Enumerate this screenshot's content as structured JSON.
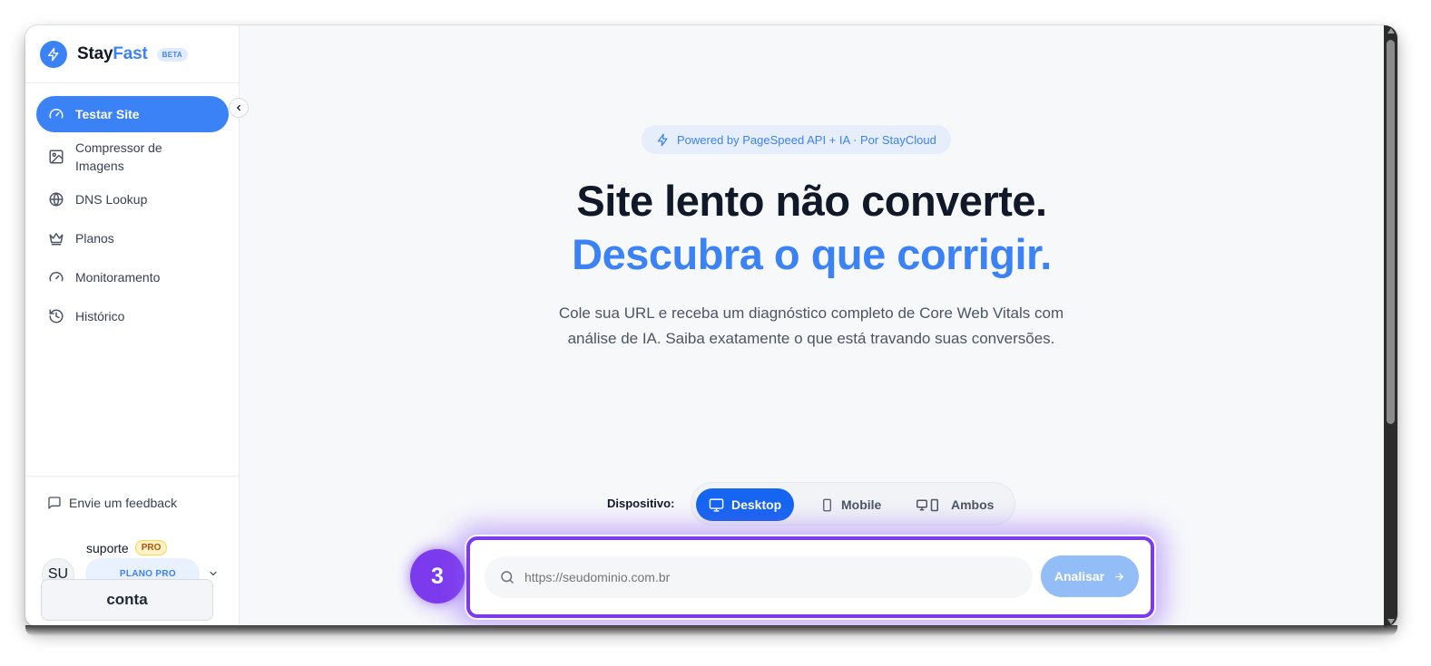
{
  "brand": {
    "name_part1": "Stay",
    "name_part2": "Fast",
    "badge": "BETA"
  },
  "sidebar": {
    "items": [
      {
        "label": "Testar Site",
        "icon": "gauge-icon",
        "active": true
      },
      {
        "label": "Compressor de Imagens",
        "icon": "image-icon",
        "active": false
      },
      {
        "label": "DNS Lookup",
        "icon": "globe-icon",
        "active": false
      },
      {
        "label": "Planos",
        "icon": "crown-icon",
        "active": false
      },
      {
        "label": "Monitoramento",
        "icon": "gauge-icon",
        "active": false
      },
      {
        "label": "Histórico",
        "icon": "history-icon",
        "active": false
      }
    ],
    "feedback_label": "Envie um feedback",
    "user": {
      "name": "suporte",
      "badge": "PRO",
      "initials": "SU",
      "plan": "PLANO PRO"
    },
    "account_button": "conta"
  },
  "main": {
    "powered_badge": "Powered by PageSpeed API + IA · Por StayCloud",
    "headline_line1": "Site lento não converte.",
    "headline_line2": "Descubra o que corrigir.",
    "subtitle": "Cole sua URL e receba um diagnóstico completo de Core Web Vitals com análise de IA. Saiba exatamente o que está travando suas conversões.",
    "device_label": "Dispositivo:",
    "devices": [
      {
        "label": "Desktop",
        "icon": "monitor-icon",
        "active": true
      },
      {
        "label": "Mobile",
        "icon": "smartphone-icon",
        "active": false
      },
      {
        "label": "Ambos",
        "icon": "monitor-smartphone-icon",
        "active": false
      }
    ],
    "url_placeholder": "https://seudominio.com.br",
    "analyze_button": "Analisar",
    "step_number": "3"
  },
  "colors": {
    "accent": "#3b82f6",
    "highlight": "#7c3aed",
    "pro_badge": "#fef3c7"
  }
}
